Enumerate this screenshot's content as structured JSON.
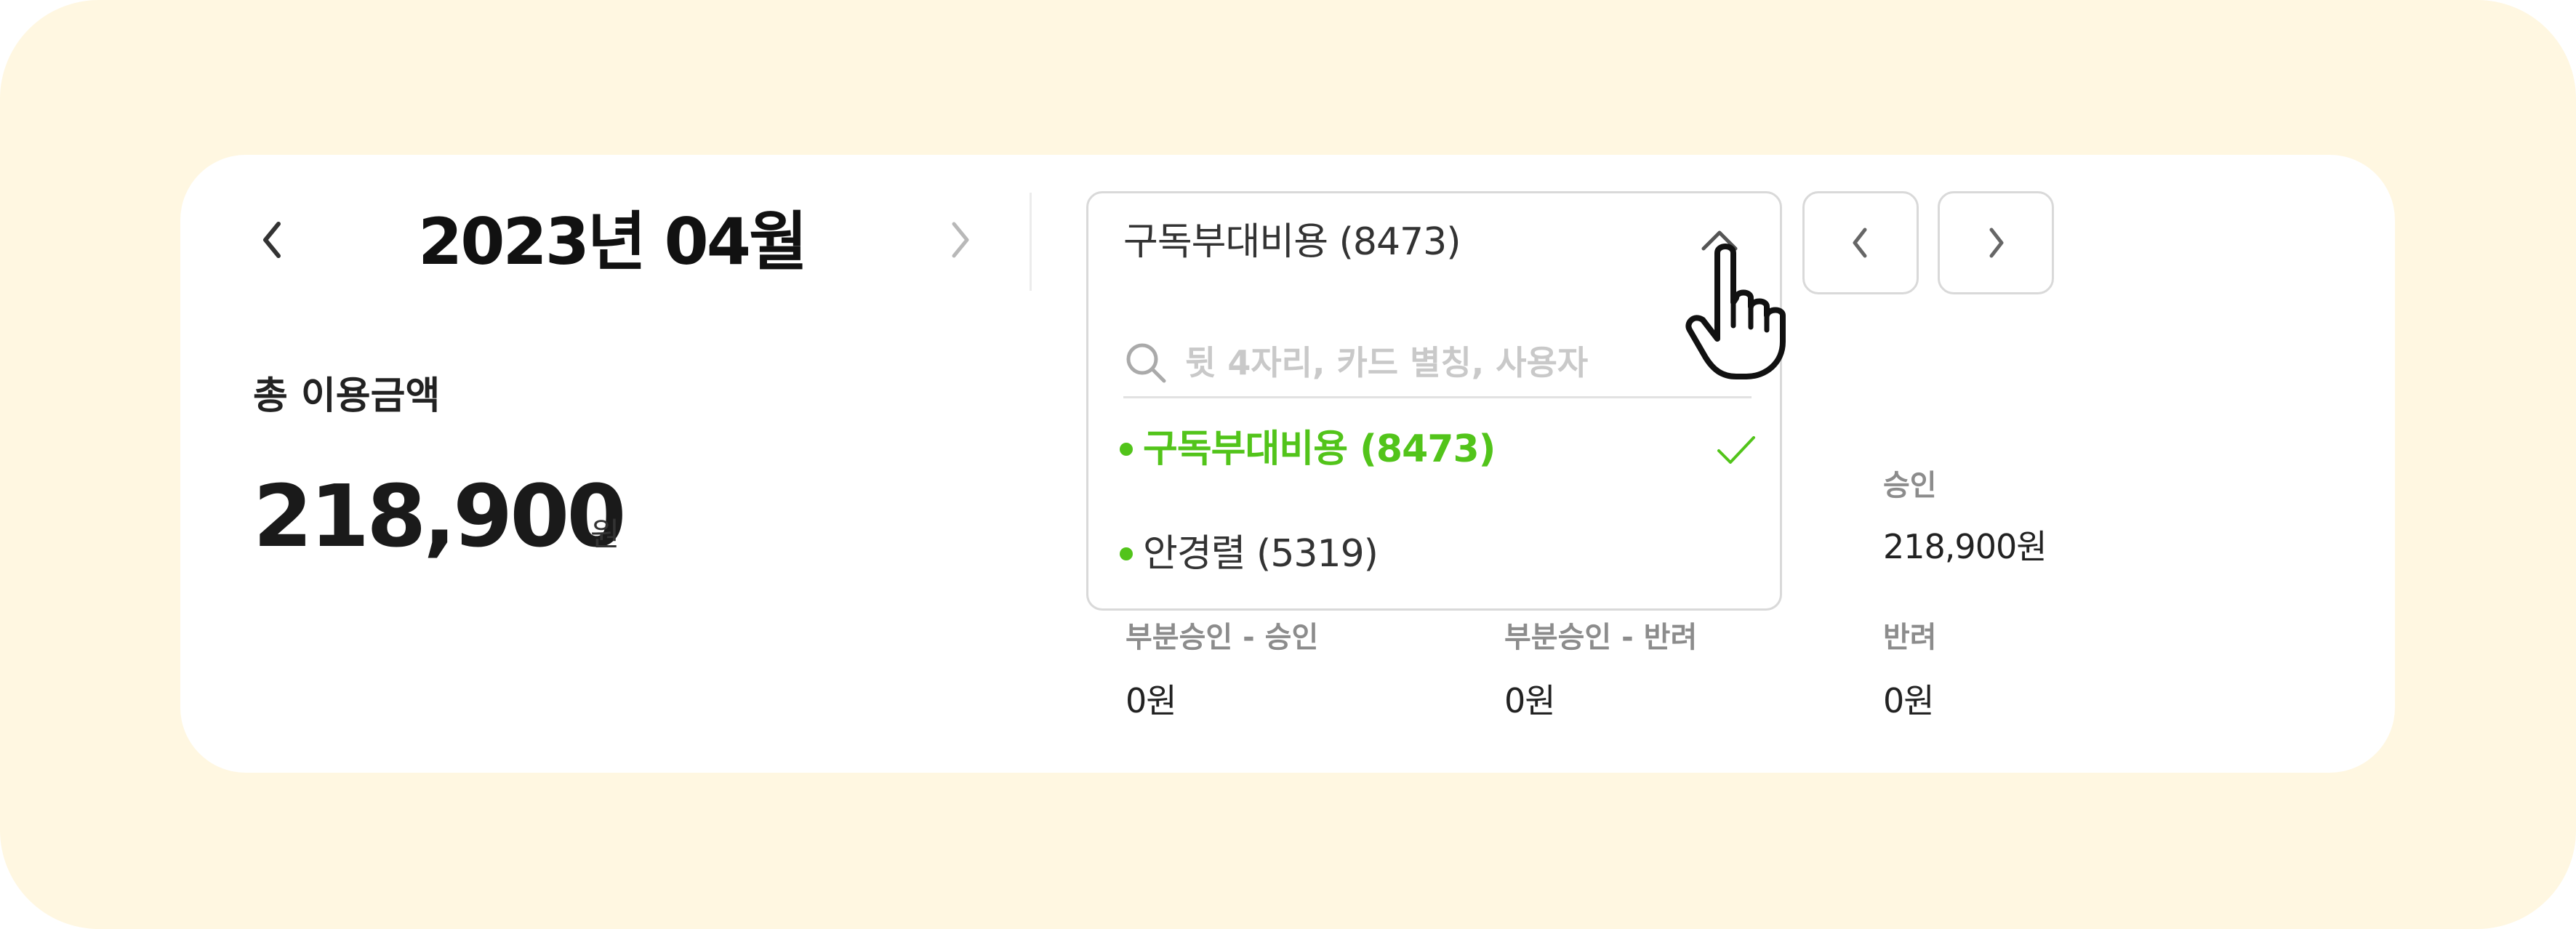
{
  "header": {
    "month_title": "2023년 04월"
  },
  "summary": {
    "total_label": "총 이용금액",
    "total_amount": "218,900",
    "total_unit": "원"
  },
  "card_select": {
    "selected_value": "구독부대비용 (8473)",
    "search_placeholder": "뒷 4자리, 카드 별칭, 사용자",
    "options": [
      {
        "label": "구독부대비용 (8473)",
        "selected": true
      },
      {
        "label": "안경렬 (5319)",
        "selected": false
      }
    ]
  },
  "stats": [
    {
      "label": "승인",
      "value": "218,900원"
    },
    {
      "label": "부분승인 - 승인",
      "value": "0원"
    },
    {
      "label": "부분승인 - 반려",
      "value": "0원"
    },
    {
      "label": "반려",
      "value": "0원"
    }
  ],
  "colors": {
    "background": "#fff7e1",
    "card": "#ffffff",
    "accent_green": "#52c41a",
    "border": "#d9d9d9"
  },
  "icons": [
    "chevron-left-icon",
    "chevron-right-icon",
    "chevron-up-icon",
    "search-icon",
    "check-icon",
    "hand-pointer-icon"
  ]
}
